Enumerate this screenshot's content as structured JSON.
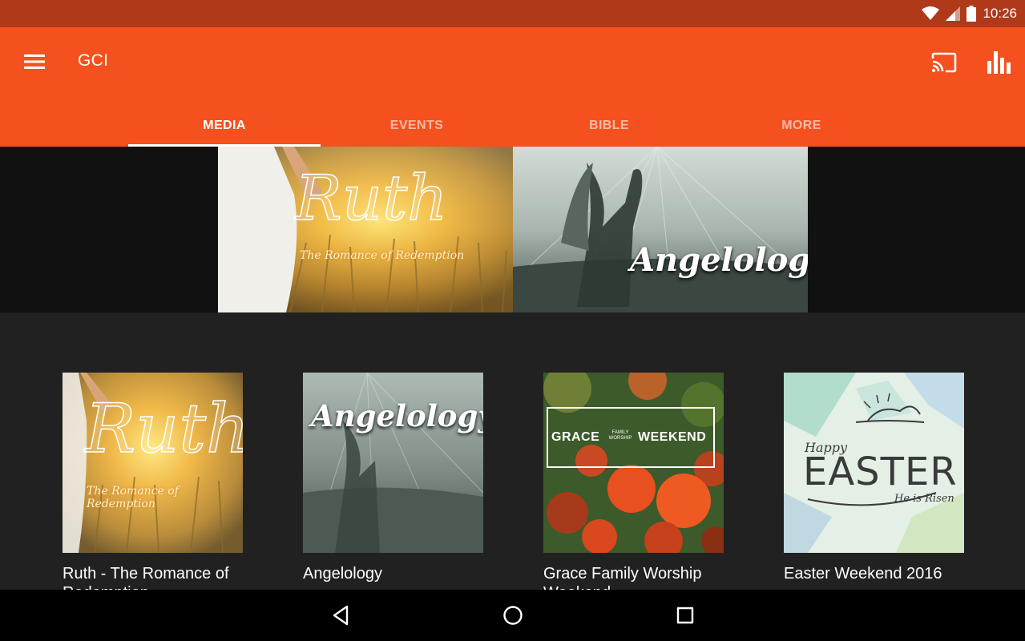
{
  "status_bar": {
    "time": "10:26",
    "icons": [
      "wifi-icon",
      "cell-signal-icon",
      "battery-icon"
    ]
  },
  "app_bar": {
    "title": "GCI",
    "menu_icon": "menu-icon",
    "cast_icon": "cast-icon",
    "stats_icon": "bar-chart-icon",
    "color": "#f4511e"
  },
  "tabs": [
    {
      "label": "MEDIA",
      "active": true
    },
    {
      "label": "EVENTS",
      "active": false
    },
    {
      "label": "BIBLE",
      "active": false
    },
    {
      "label": "MORE",
      "active": false
    }
  ],
  "banner": {
    "items": [
      {
        "title": "Ruth",
        "subtitle": "The Romance of Redemption"
      },
      {
        "title": "Angelology"
      }
    ]
  },
  "cards": [
    {
      "title": "Ruth - The Romance of Redemption",
      "art_title": "Ruth",
      "art_subtitle": "The Romance of Redemption"
    },
    {
      "title": "Angelology",
      "art_title": "Angelology"
    },
    {
      "title": "Grace Family Worship Weekend",
      "art_left": "GRACE",
      "art_small_top": "FAMILY",
      "art_small_bottom": "WORSHIP",
      "art_right": "WEEKEND"
    },
    {
      "title": "Easter Weekend 2016",
      "art_happy": "Happy",
      "art_title": "EASTER",
      "art_subtitle": "He is Risen"
    }
  ],
  "nav_bar": {
    "back_icon": "back-icon",
    "home_icon": "home-icon",
    "recents_icon": "recents-icon"
  }
}
